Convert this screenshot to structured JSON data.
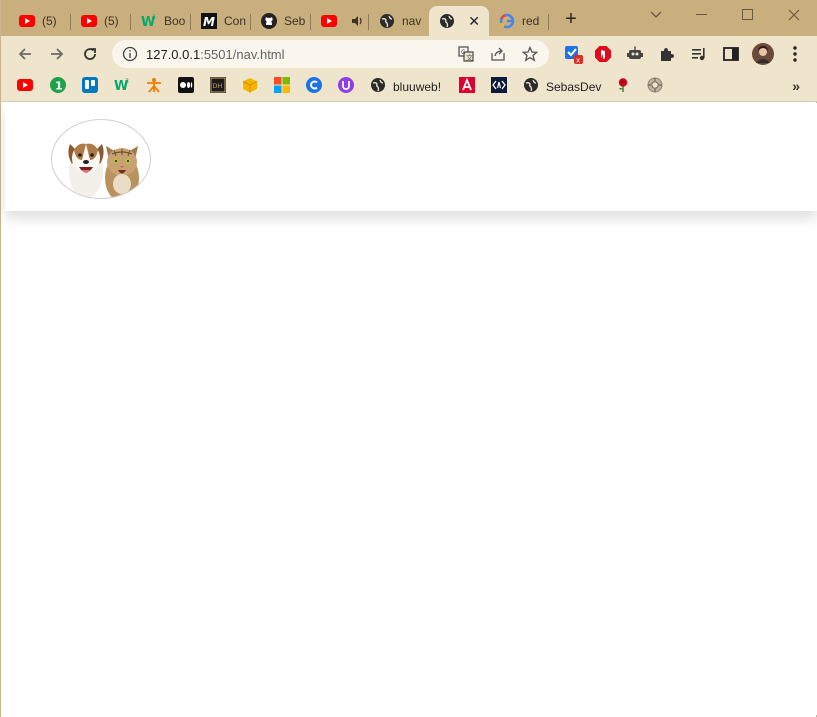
{
  "browser": {
    "tabs": [
      {
        "title": "(5) ",
        "favicon": "youtube-icon"
      },
      {
        "title": "(5) ",
        "favicon": "youtube-icon"
      },
      {
        "title": "Boo",
        "favicon": "w3schools-icon"
      },
      {
        "title": "Con",
        "favicon": "m-logo-icon"
      },
      {
        "title": "Seb",
        "favicon": "github-icon"
      },
      {
        "title": "",
        "favicon": "youtube-icon",
        "audio": "speaker-icon"
      },
      {
        "title": "nav",
        "favicon": "globe-icon"
      },
      {
        "title": "",
        "favicon": "globe-icon",
        "active": true,
        "close": "✕"
      },
      {
        "title": "red",
        "favicon": "google-icon"
      }
    ],
    "new_tab": "+",
    "window_controls": {
      "minimize": "—",
      "maximize": "☐",
      "close": "✕",
      "dropdown": "⌄"
    },
    "toolbar": {
      "url_host": "127.0.0.1",
      "url_rest": ":5501/nav.html"
    },
    "bookmarks": [
      {
        "label": "",
        "icon": "youtube-icon"
      },
      {
        "label": "",
        "icon": "green-number-icon"
      },
      {
        "label": "",
        "icon": "trello-icon"
      },
      {
        "label": "",
        "icon": "w3schools-icon"
      },
      {
        "label": "",
        "icon": "sena-icon"
      },
      {
        "label": "",
        "icon": "medium-icon"
      },
      {
        "label": "",
        "icon": "dh-icon"
      },
      {
        "label": "",
        "icon": "box-icon"
      },
      {
        "label": "",
        "icon": "microsoft-icon"
      },
      {
        "label": "",
        "icon": "c-icon"
      },
      {
        "label": "",
        "icon": "purple-shield-icon"
      },
      {
        "label": "bluuweb!",
        "icon": "globe-icon"
      },
      {
        "label": "",
        "icon": "angular-icon"
      },
      {
        "label": "",
        "icon": "code-icon"
      },
      {
        "label": "SebasDev",
        "icon": "globe-icon"
      },
      {
        "label": "",
        "icon": "rose-icon"
      },
      {
        "label": "",
        "icon": "gear-badge-icon"
      }
    ],
    "bookmarks_more": "»"
  },
  "page": {
    "logo_alt": "dog-and-cat-logo"
  },
  "colors": {
    "tabstrip": "#c9ae7e",
    "toolbar": "#efe4cc",
    "page_bg": "#ffffff"
  }
}
